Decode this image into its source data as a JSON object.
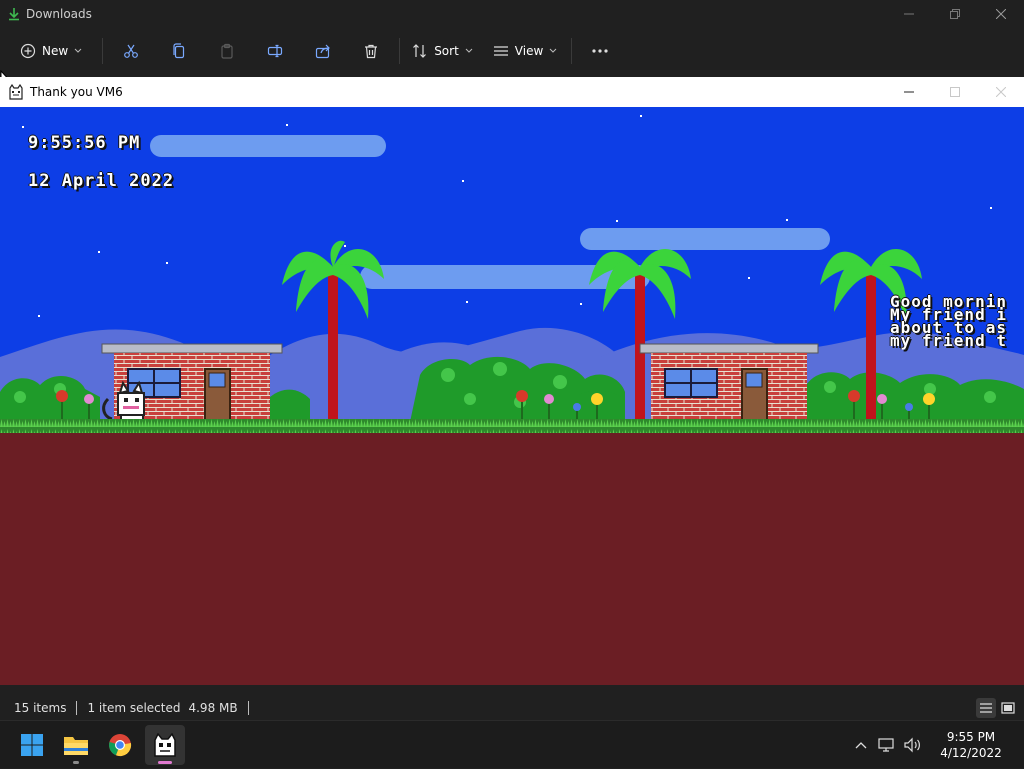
{
  "explorer": {
    "title": "Downloads",
    "toolbar": {
      "new_label": "New",
      "sort_label": "Sort",
      "view_label": "View"
    }
  },
  "game_window": {
    "title": "Thank you VM6",
    "time": "9:55:56 PM",
    "date": "12 April 2022",
    "dialog_lines": [
      "Good mornin",
      "My friend i",
      "about to as",
      "my friend t"
    ]
  },
  "statusbar": {
    "items_count": "15 items",
    "selection": "1 item selected",
    "size": "4.98 MB"
  },
  "taskbar": {
    "apps": [
      "start-button",
      "file-explorer",
      "chrome",
      "cat-game"
    ],
    "time": "9:55 PM",
    "date": "4/12/2022"
  },
  "colors": {
    "sky": "#0d3ee6",
    "ground": "#6b1e24",
    "grass": "#3fa83a",
    "brick": "#c8403c",
    "accent_chrome": "#202020"
  }
}
